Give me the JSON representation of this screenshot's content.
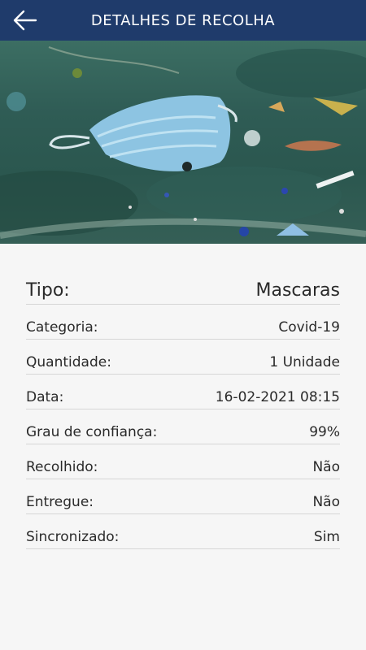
{
  "header": {
    "title": "DETALHES DE RECOLHA",
    "back_icon": "arrow-left-icon"
  },
  "photo": {
    "description_icon": "photo"
  },
  "details": {
    "tipo": {
      "label": "Tipo:",
      "value": "Mascaras"
    },
    "rows": [
      {
        "label": "Categoria:",
        "value": "Covid-19"
      },
      {
        "label": "Quantidade:",
        "value": "1 Unidade"
      },
      {
        "label": "Data:",
        "value": "16-02-2021 08:15"
      },
      {
        "label": "Grau de confiança:",
        "value": "99%"
      },
      {
        "label": "Recolhido:",
        "value": "Não"
      },
      {
        "label": "Entregue:",
        "value": "Não"
      },
      {
        "label": "Sincronizado:",
        "value": "Sim"
      }
    ]
  }
}
